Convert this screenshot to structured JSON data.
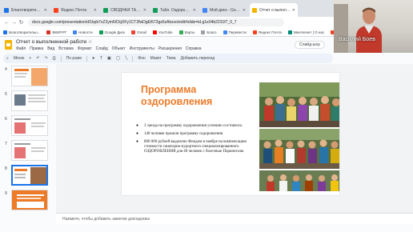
{
  "browser": {
    "tabs": [
      {
        "label": "Благотворительна",
        "color": "#1a73e8",
        "active": false
      },
      {
        "label": "Яндекс Почта",
        "color": "#fc3f1d",
        "active": false
      },
      {
        "label": "СВОДНАЯ ТАБЛИЦА - Googl",
        "color": "#0f9d58",
        "active": false
      },
      {
        "label": "Табл. Оздоровительные прогр",
        "color": "#0f9d58",
        "active": false
      },
      {
        "label": "Мой диск - Google Диск",
        "color": "#4285f4",
        "active": false
      },
      {
        "label": "Отчет о выполненной работ",
        "color": "#f4b400",
        "active": true
      }
    ],
    "address": "docs.google.com/presentation/d/1kpb7vZ2ym6lCkjXFy1CT2fwDgEt573gs5zAksvo/edit#slide=id.g1e04b2231f7_0_7",
    "bookmarks": [
      "Благотворительн...",
      "ВКИР.РГ",
      "Новости",
      "Google Диск",
      "Gmail",
      "YouTube",
      "Карты",
      "Благо",
      "Перевести",
      "Яндекс Почта",
      "Минтелнет | О нас",
      "Яндекс",
      "(17) Deep Forest - ..."
    ]
  },
  "docs": {
    "title": "Отчет о выполненной работе",
    "menus": [
      "Файл",
      "Правка",
      "Вид",
      "Вставка",
      "Формат",
      "Слайд",
      "Объект",
      "Инструменты",
      "Расширения",
      "Справка"
    ],
    "slideshow_label": "Слайд-шоу",
    "toolbar": {
      "menus_label": "Меню",
      "fit_label": "По разм",
      "background_label": "Фон",
      "layout_label": "Макет",
      "theme_label": "Тема",
      "transition_label": "Добавить переход"
    },
    "notes_placeholder": "Нажмите, чтобы добавить заметки докладчика"
  },
  "filmstrip": {
    "slides": [
      {
        "number": "4",
        "selected": false
      },
      {
        "number": "5",
        "selected": false
      },
      {
        "number": "6",
        "selected": false
      },
      {
        "number": "7",
        "selected": false
      },
      {
        "number": "8",
        "selected": true
      },
      {
        "number": "9",
        "selected": false
      }
    ]
  },
  "slide": {
    "title": "Программа оздоровления",
    "bullets": [
      "3 заезда на программу оздоровления успешно состоялось",
      "140 человек прошли программу оздоровления",
      "800 000 рублей выделено Фондом в ноябре на компенсацию стоимости санаторно-курортного специализированного ОЗДОРОВЛЕНИЯ для 40 человек с болезнью Паркинсона"
    ],
    "accent_color": "#ec7a27"
  },
  "video": {
    "name": "Василий Боев"
  }
}
